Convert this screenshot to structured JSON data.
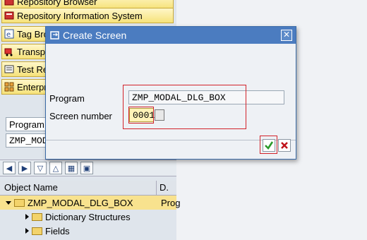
{
  "background": {
    "nav_buttons": [
      {
        "label": "Repository Browser",
        "icon": "repository-browser-icon"
      },
      {
        "label": "Repository Information System",
        "icon": "repository-info-icon"
      },
      {
        "label": "Tag Bro",
        "icon": "tag-browser-icon"
      },
      {
        "label": "Transpo",
        "icon": "transport-icon"
      },
      {
        "label": "Test Re",
        "icon": "test-repository-icon"
      },
      {
        "label": "Enterpr",
        "icon": "enterprise-icon"
      }
    ],
    "selection": {
      "type_label": "Program",
      "name_value": "ZMP_MODA"
    },
    "tree": {
      "col_object_name": "Object Name",
      "col_desc": "D.",
      "rows": [
        {
          "label": "ZMP_MODAL_DLG_BOX",
          "col2": "Prog"
        },
        {
          "label": "Dictionary Structures",
          "col2": ""
        },
        {
          "label": "Fields",
          "col2": ""
        }
      ]
    }
  },
  "dialog": {
    "title": "Create Screen",
    "program_label": "Program",
    "program_value": "ZMP_MODAL_DLG_BOX",
    "screen_number_label": "Screen number",
    "screen_number_value": "0001"
  },
  "colors": {
    "title_bar": "#4b7cc0",
    "highlight_red": "#d2232a",
    "nav_button_yellow": "#f6e27a",
    "confirm_green": "#2c9a2c",
    "cancel_red": "#c0141c"
  }
}
